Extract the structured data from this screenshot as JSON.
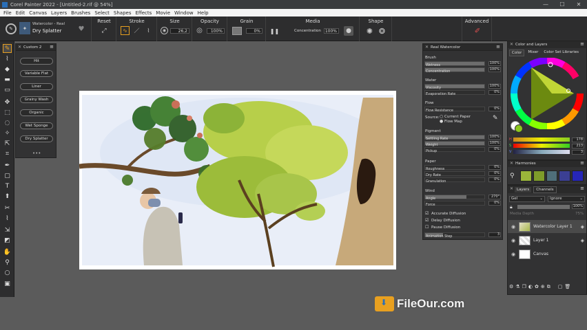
{
  "window": {
    "title": "Corel Painter 2022 - [Untitled-2.rif @ 54%]",
    "controls": [
      "—",
      "☐",
      "✕"
    ]
  },
  "menu": [
    "File",
    "Edit",
    "Canvas",
    "Layers",
    "Brushes",
    "Select",
    "Shapes",
    "Effects",
    "Movie",
    "Window",
    "Help"
  ],
  "propbar": {
    "brush_category": "Watercolor - Real",
    "brush_variant": "Dry Splatter",
    "sections": {
      "reset": "Reset",
      "stroke": "Stroke",
      "size": "Size",
      "opacity": "Opacity",
      "grain": "Grain",
      "media": "Media",
      "shape": "Shape",
      "advanced": "Advanced"
    },
    "size_value": "26,2",
    "opacity_value": "100%",
    "grain_value": "0%",
    "concentration_label": "Concentration",
    "concentration_value": "100%"
  },
  "custom_palette": {
    "title": "Custom 2",
    "buttons": [
      "Hit",
      "Variable Flat",
      "Liner",
      "Grainy Wash",
      "Organic",
      "Wet Sponge",
      "Dry Splatter"
    ]
  },
  "watercolor_panel": {
    "title": "Real Watercolor",
    "brush": {
      "heading": "Brush",
      "rows": [
        {
          "label": "Wetness",
          "value": "100%"
        },
        {
          "label": "Concentration",
          "value": "100%"
        }
      ]
    },
    "water": {
      "heading": "Water",
      "rows": [
        {
          "label": "Viscosity",
          "value": "100%"
        },
        {
          "label": "Evaporation Rate",
          "value": "0%"
        }
      ]
    },
    "flow": {
      "heading": "Flow",
      "resistance_label": "Flow Resistance",
      "resistance_value": "0%",
      "source_label": "Source:",
      "option1": "Current Paper",
      "option2": "Flow Map"
    },
    "pigment": {
      "heading": "Pigment",
      "rows": [
        {
          "label": "Settling Rate",
          "value": "100%"
        },
        {
          "label": "Weight",
          "value": "100%"
        },
        {
          "label": "Pickup",
          "value": "0%"
        }
      ]
    },
    "paper": {
      "heading": "Paper",
      "rows": [
        {
          "label": "Roughness",
          "value": "0%"
        },
        {
          "label": "Dry Rate",
          "value": "0%"
        },
        {
          "label": "Granulation",
          "value": "0%"
        }
      ]
    },
    "wind": {
      "heading": "Wind",
      "rows": [
        {
          "label": "Angle",
          "value": "270°"
        },
        {
          "label": "Force",
          "value": "0%"
        }
      ]
    },
    "checks": [
      "Accurate Diffusion",
      "Delay Diffusion",
      "Pause Diffusion"
    ],
    "animation_label": "Animation Step",
    "animation_value": "3"
  },
  "color_panel": {
    "title": "Color and Layers",
    "tabs": [
      "Color",
      "Mixer",
      "Color Set Libraries"
    ],
    "h_label": "H",
    "s_label": "S",
    "v_label": "V",
    "h_value": "178",
    "s_value": "213",
    "v_value": "3"
  },
  "harmonies": {
    "title": "Harmonies",
    "swatches": [
      "#9ab53a",
      "#7e9c2a",
      "#4f6f7a",
      "#3b3f93",
      "#2626b8"
    ]
  },
  "layers": {
    "tabs": [
      "Layers",
      "Channels"
    ],
    "blend": "Gel",
    "composite": "Ignore",
    "opacity": "100%",
    "depth_label": "Media Depth",
    "depth_value": "75%",
    "items": [
      {
        "name": "Watercolor Layer 1",
        "selected": true
      },
      {
        "name": "Layer 1",
        "selected": false
      },
      {
        "name": "Canvas",
        "selected": false
      }
    ]
  },
  "watermark": {
    "text": "FileOur.com"
  },
  "colors": {
    "accent": "#e8a020",
    "panel": "#323233",
    "slider_fill": "#6d6d6d"
  }
}
